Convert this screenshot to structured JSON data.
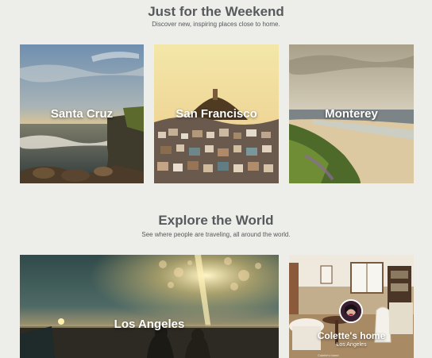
{
  "weekend": {
    "title": "Just for the Weekend",
    "subtitle": "Discover new, inspiring places close to home.",
    "cards": [
      {
        "label": "Santa Cruz"
      },
      {
        "label": "San Francisco"
      },
      {
        "label": "Monterey"
      }
    ]
  },
  "world": {
    "title": "Explore the World",
    "subtitle": "See where people are traveling, all around the world.",
    "cards": [
      {
        "label": "Los Angeles"
      },
      {
        "label": "Colette's home",
        "sublabel": "Los Angeles",
        "caption": "Colette's home"
      }
    ]
  }
}
